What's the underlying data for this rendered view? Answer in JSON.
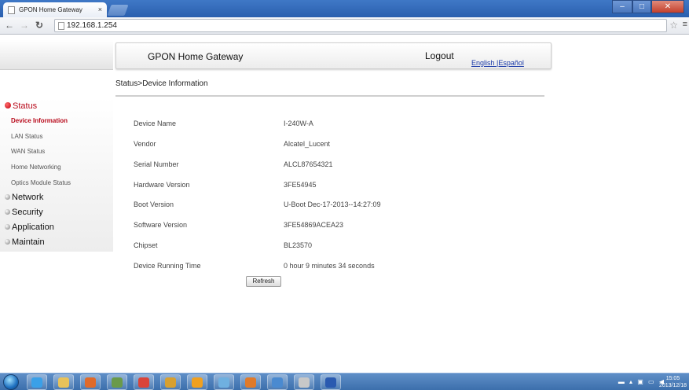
{
  "browser": {
    "tab_title": "GPON Home Gateway",
    "tab_close": "×",
    "url": "192.168.1.254",
    "win_min": "–",
    "win_max": "□",
    "win_close": "✕"
  },
  "header": {
    "title": "GPON Home Gateway",
    "logout": "Logout",
    "language": "English |Español"
  },
  "breadcrumb": "Status>Device Information",
  "sidebar": {
    "status_label": "Status",
    "status_items": [
      {
        "label": "Device Information",
        "active": true
      },
      {
        "label": "LAN Status"
      },
      {
        "label": "WAN Status"
      },
      {
        "label": "Home Networking"
      },
      {
        "label": "Optics Module Status"
      }
    ],
    "sections": [
      "Network",
      "Security",
      "Application",
      "Maintain"
    ]
  },
  "device_info": [
    {
      "label": "Device Name",
      "value": "I-240W-A"
    },
    {
      "label": "Vendor",
      "value": "Alcatel_Lucent"
    },
    {
      "label": "Serial Number",
      "value": "ALCL87654321"
    },
    {
      "label": "Hardware Version",
      "value": "3FE54945"
    },
    {
      "label": "Boot Version",
      "value": "U-Boot Dec-17-2013--14:27:09"
    },
    {
      "label": "Software Version",
      "value": "3FE54869ACEA23"
    },
    {
      "label": "Chipset",
      "value": "BL23570"
    },
    {
      "label": "Device Running Time",
      "value": "0 hour 9 minutes 34 seconds"
    }
  ],
  "refresh_label": "Refresh",
  "taskbar": {
    "clock_time": "15:05",
    "clock_date": "2013/12/18",
    "apps": [
      {
        "icon": "internet-explorer-icon",
        "color": "#3aa0e8"
      },
      {
        "icon": "file-explorer-icon",
        "color": "#e8c25a"
      },
      {
        "icon": "firefox-icon",
        "color": "#e06a2a"
      },
      {
        "icon": "tools-icon",
        "color": "#6a9a4a"
      },
      {
        "icon": "chrome-icon",
        "color": "#d9443a"
      },
      {
        "icon": "notes-icon",
        "color": "#d8a030"
      },
      {
        "icon": "outlook-icon",
        "color": "#f0a020"
      },
      {
        "icon": "network-icon",
        "color": "#6fb0e0"
      },
      {
        "icon": "users-icon",
        "color": "#e07a2a"
      },
      {
        "icon": "remote-desktop-icon",
        "color": "#4a8ad0"
      },
      {
        "icon": "media-icon",
        "color": "#c8c8c8"
      },
      {
        "icon": "word-icon",
        "color": "#2a5ab0"
      }
    ]
  }
}
